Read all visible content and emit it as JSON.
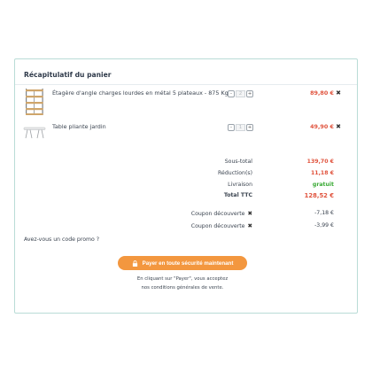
{
  "cart": {
    "title": "Récapitulatif du panier",
    "items": [
      {
        "name": "Étagère d'angle charges lourdes en métal 5 plateaux - 875 Kg",
        "qty": "2",
        "minus": "-",
        "plus": "+",
        "price": "89,80 €",
        "remove_icon": "close-icon"
      },
      {
        "name": "Table pliante jardin",
        "qty": "1",
        "minus": "-",
        "plus": "+",
        "price": "49,90 €",
        "remove_icon": "close-icon"
      }
    ],
    "summary": {
      "subtotal_label": "Sous-total",
      "subtotal_value": "139,70 €",
      "discount_label": "Réduction(s)",
      "discount_value": "11,18 €",
      "shipping_label": "Livraison",
      "shipping_value": "gratuit",
      "total_label": "Total TTC",
      "total_value": "128,52 €"
    },
    "coupons": [
      {
        "label": "Coupon découverte",
        "value": "-7,18 €"
      },
      {
        "label": "Coupon découverte",
        "value": "-3,99 €"
      }
    ],
    "promo_text": "Avez-vous un code promo ?",
    "pay_button": "Payer en toute sécurité maintenant",
    "legal_line1": "En cliquant sur \"Payer\", vous acceptez",
    "legal_line2": "nos conditions générales de vente.",
    "colors": {
      "accent": "#f3973f",
      "price": "#e0533d",
      "free": "#3aaa35",
      "border": "#b9dcd6"
    }
  }
}
